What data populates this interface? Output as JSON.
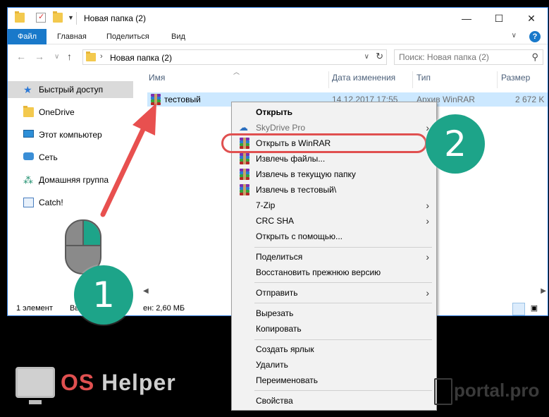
{
  "window": {
    "title": "Новая папка (2)",
    "controls": {
      "minimize": "—",
      "maximize": "☐",
      "close": "✕"
    }
  },
  "ribbon": {
    "tabs": [
      "Файл",
      "Главная",
      "Поделиться",
      "Вид"
    ],
    "help": "?"
  },
  "address": {
    "crumb": "Новая папка (2)",
    "search_placeholder": "Поиск: Новая папка (2)"
  },
  "sidebar": {
    "items": [
      {
        "label": "Быстрый доступ",
        "icon": "star-icon"
      },
      {
        "label": "OneDrive",
        "icon": "folder-icon"
      },
      {
        "label": "Этот компьютер",
        "icon": "computer-icon"
      },
      {
        "label": "Сеть",
        "icon": "network-icon"
      },
      {
        "label": "Домашняя группа",
        "icon": "homegroup-icon"
      },
      {
        "label": "Catch!",
        "icon": "catch-icon"
      }
    ]
  },
  "columns": {
    "name": "Имя",
    "date": "Дата изменения",
    "type": "Тип",
    "size": "Размер"
  },
  "file": {
    "name": "тестовый",
    "date": "14.12.2017 17:55",
    "type": "Архив WinRAR",
    "size": "2 672 K"
  },
  "status": {
    "count": "1 элемент",
    "selected_prefix": "Вы",
    "selected_size": "ен: 2,60 МБ"
  },
  "context_menu": {
    "open": "Открыть",
    "skydrive": "SkyDrive Pro",
    "open_winrar": "Открыть в WinRAR",
    "extract_files": "Извлечь файлы...",
    "extract_here": "Извлечь в текущую папку",
    "extract_to": "Извлечь в тестовый\\",
    "zip7": "7-Zip",
    "crc": "CRC SHA",
    "open_with": "Открыть с помощью...",
    "share": "Поделиться",
    "restore": "Восстановить прежнюю версию",
    "send_to": "Отправить",
    "cut": "Вырезать",
    "copy": "Копировать",
    "shortcut": "Создать ярлык",
    "delete": "Удалить",
    "rename": "Переименовать",
    "properties": "Свойства"
  },
  "annotations": {
    "step1": "1",
    "step2": "2",
    "arrow_color": "#e8504f",
    "badge_color": "#1da489"
  },
  "logos": {
    "left_os": "OS",
    "left_rest": " Helper",
    "right": "portal.pro"
  }
}
